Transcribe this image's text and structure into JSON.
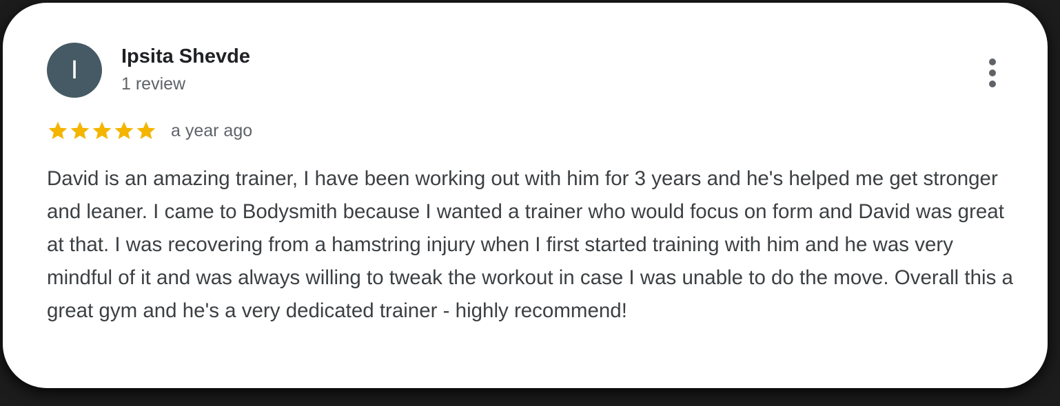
{
  "review": {
    "avatar": {
      "initial": "I",
      "color": "#455a64"
    },
    "reviewer_name": "Ipsita Shevde",
    "reviewer_review_count": "1 review",
    "rating": 5,
    "rating_max": 5,
    "star_color": "#f4b400",
    "date": "a year ago",
    "text": "David is an amazing trainer, I have been working out with him for 3 years and he's helped me get stronger and leaner. I came to Bodysmith because I wanted a trainer who would focus on form and David was great at that. I was recovering from a hamstring injury when I first started training with him and he was very mindful of it and was always willing to tweak the workout in case I was unable to do the move. Overall this a great gym and he's a very dedicated trainer - highly recommend!",
    "menu_icon": "more-vert-icon"
  }
}
